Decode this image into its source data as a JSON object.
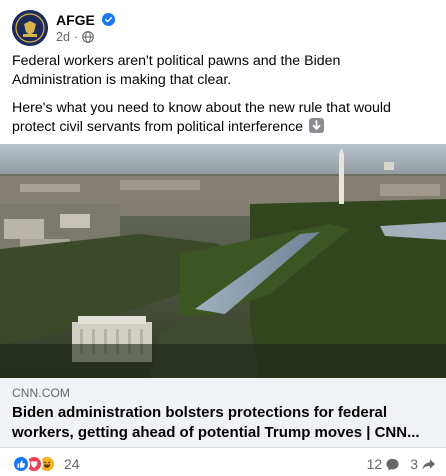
{
  "post": {
    "page_name": "AFGE",
    "time": "2d",
    "meta_separator": "·",
    "paragraph_1": "Federal workers aren't political pawns and the Biden Administration is making that clear.",
    "paragraph_2": "Here's what you need to know about the new rule that would protect civil servants from political interference"
  },
  "link": {
    "domain": "CNN.COM",
    "title": "Biden administration bolsters protections for federal workers, getting ahead of potential Trump moves | CNN..."
  },
  "engagement": {
    "reactions_count": "24",
    "comments_count": "12",
    "shares_count": "3"
  },
  "colors": {
    "brand_blue": "#1877f2",
    "love_red": "#f33e58",
    "haha_yellow": "#f7b125",
    "muted": "#65676b"
  },
  "icons": [
    "verified-badge-icon",
    "globe-icon",
    "down-arrow-emoji-icon",
    "like-reaction-icon",
    "love-reaction-icon",
    "haha-reaction-icon",
    "comment-icon",
    "share-icon"
  ]
}
